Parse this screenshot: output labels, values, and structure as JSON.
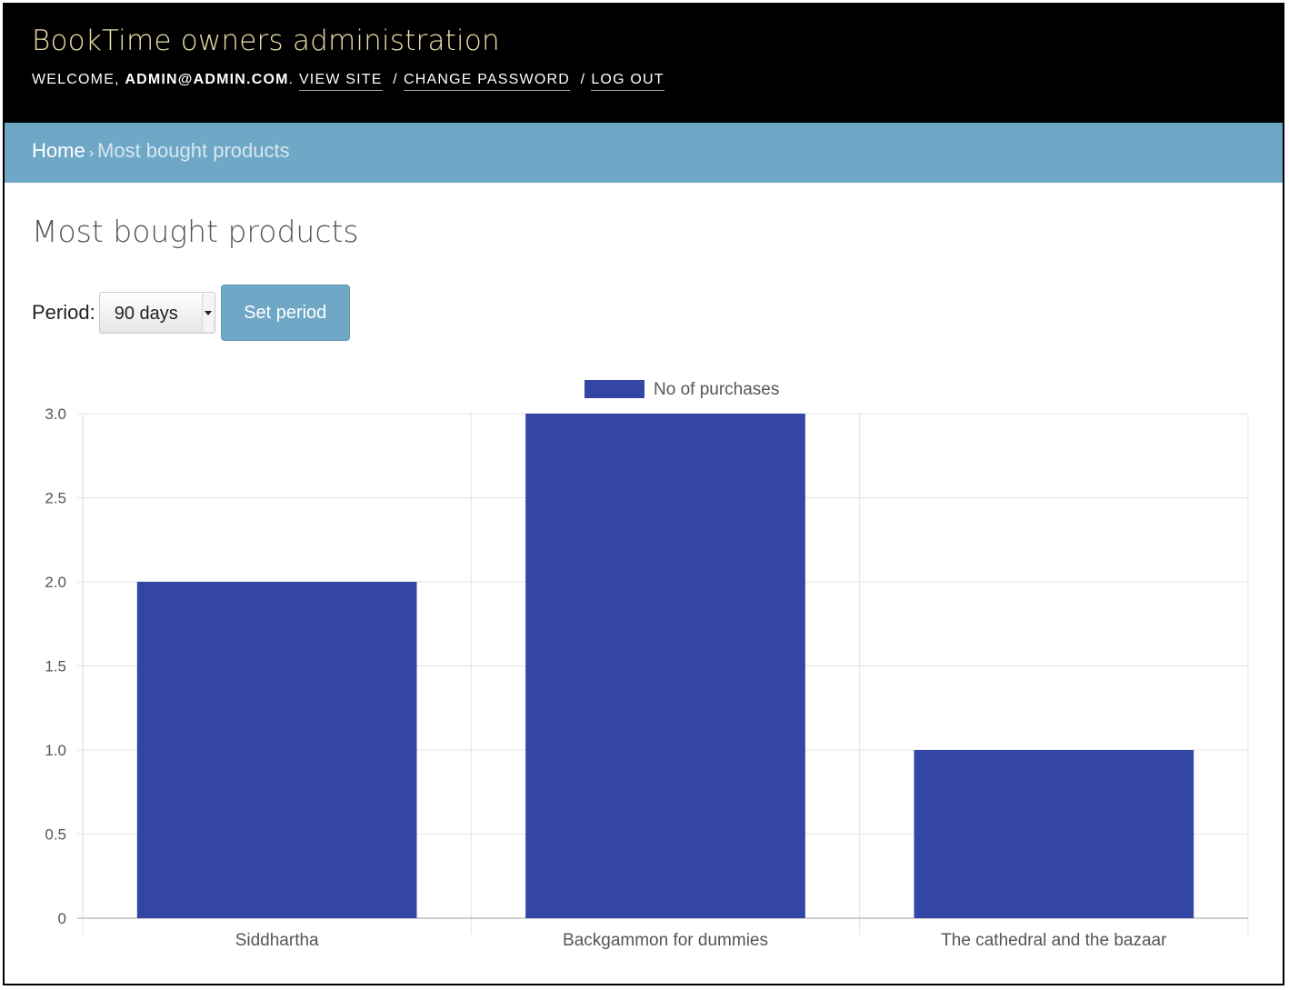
{
  "header": {
    "site_title": "BookTime owners administration",
    "welcome_prefix": "WELCOME, ",
    "user": "ADMIN@ADMIN.COM",
    "after_user": ".",
    "view_site": "VIEW SITE",
    "separator": "/",
    "change_password": "CHANGE PASSWORD",
    "log_out": "LOG OUT"
  },
  "breadcrumbs": {
    "home": "Home",
    "arrow": "›",
    "current": "Most bought products"
  },
  "page": {
    "title": "Most bought products"
  },
  "form": {
    "period_label": "Period:",
    "period_value": "90 days",
    "submit_label": "Set period"
  },
  "colors": {
    "header_bg": "#000000",
    "breadcrumb_bg": "#6fa7c6",
    "button_bg": "#6fa7c6",
    "bar_color": "#3346a3"
  },
  "chart_data": {
    "type": "bar",
    "categories": [
      "Siddhartha",
      "Backgammon for dummies",
      "The cathedral and the bazaar"
    ],
    "series": [
      {
        "name": "No of purchases",
        "values": [
          2,
          3,
          1
        ]
      }
    ],
    "ylim": [
      0,
      3
    ],
    "yticks": [
      "0",
      "0.5",
      "1.0",
      "1.5",
      "2.0",
      "2.5",
      "3.0"
    ],
    "yticks_values": [
      0,
      0.5,
      1,
      1.5,
      2,
      2.5,
      3
    ],
    "legend": "top-center",
    "grid": true
  }
}
